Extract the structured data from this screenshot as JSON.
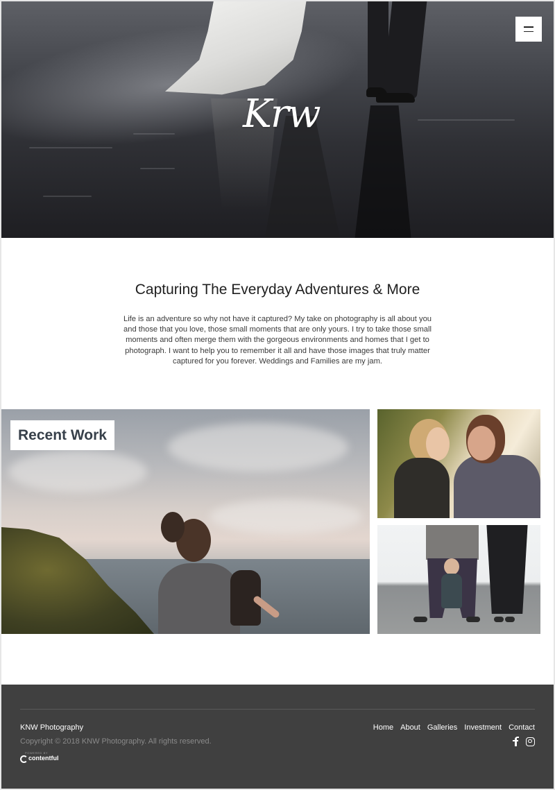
{
  "hero": {
    "logo_text": "Krw",
    "menu_icon": "hamburger-icon"
  },
  "intro": {
    "heading": "Capturing The Everyday Adventures & More",
    "body": "Life is an adventure so why not have it captured? My take on photography is all about you and those that you love, those small moments that are only yours. I try to take those small moments and often merge them with the gorgeous environments and homes that I get to photograph. I want to help you to remember it all and have those images that truly matter captured for you forever. Weddings and Families are my jam."
  },
  "recent_work": {
    "label": "Recent Work"
  },
  "footer": {
    "brand": "KNW Photography",
    "copyright": "Copyright © 2018 KNW Photography. All rights reserved.",
    "powered_by": "POWERED BY",
    "powered_logo": "contentful",
    "nav": [
      "Home",
      "About",
      "Galleries",
      "Investment",
      "Contact"
    ],
    "social": [
      "facebook-icon",
      "instagram-icon"
    ]
  },
  "colors": {
    "footer_bg": "#404040",
    "badge_text": "#37404a",
    "heading_text": "#1f1f1f"
  }
}
